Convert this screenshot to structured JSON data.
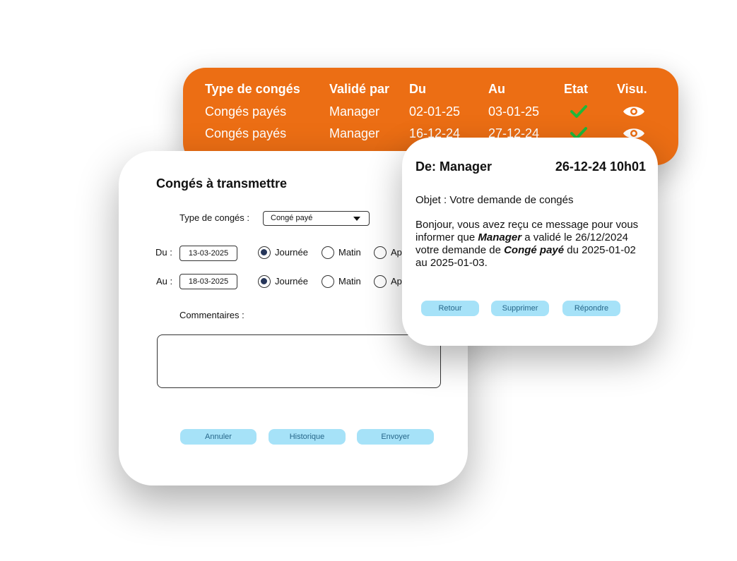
{
  "history": {
    "headers": {
      "type": "Type de congés",
      "validated_by": "Validé par",
      "from": "Du",
      "to": "Au",
      "status": "Etat",
      "view": "Visu."
    },
    "rows": [
      {
        "type": "Congés payés",
        "validated_by": "Manager",
        "from": "02-01-25",
        "to": "03-01-25",
        "status_icon": "check-icon",
        "view_icon": "eye-icon"
      },
      {
        "type": "Congés payés",
        "validated_by": "Manager",
        "from": "16-12-24",
        "to": "27-12-24",
        "status_icon": "check-icon",
        "view_icon": "eye-icon"
      }
    ],
    "bg_color": "#ec6e14",
    "check_color": "#1fb83a"
  },
  "form": {
    "title": "Congés à transmettre",
    "type_label": "Type de congés :",
    "type_value": "Congé payé",
    "from_label": "Du :",
    "from_value": "13-03-2025",
    "to_label": "Au :",
    "to_value": "18-03-2025",
    "radio_day": "Journée",
    "radio_morning": "Matin",
    "radio_afternoon_visible": "Ap",
    "comments_label": "Commentaires :",
    "buttons": {
      "cancel": "Annuler",
      "history": "Historique",
      "send": "Envoyer"
    },
    "button_color": "#a6e2f8"
  },
  "message": {
    "from": "De: Manager",
    "datetime": "26-12-24 10h01",
    "subject": "Objet : Votre demande de congés",
    "body": {
      "part1": "Bonjour, vous avez reçu ce message pour vous informer que ",
      "who": "Manager",
      "part2": " a validé le 26/12/2024 votre demande de ",
      "what": "Congé payé",
      "part3": " du 2025-01-02 au 2025-01-03."
    },
    "buttons": {
      "back": "Retour",
      "delete": "Supprimer",
      "reply": "Répondre"
    }
  }
}
